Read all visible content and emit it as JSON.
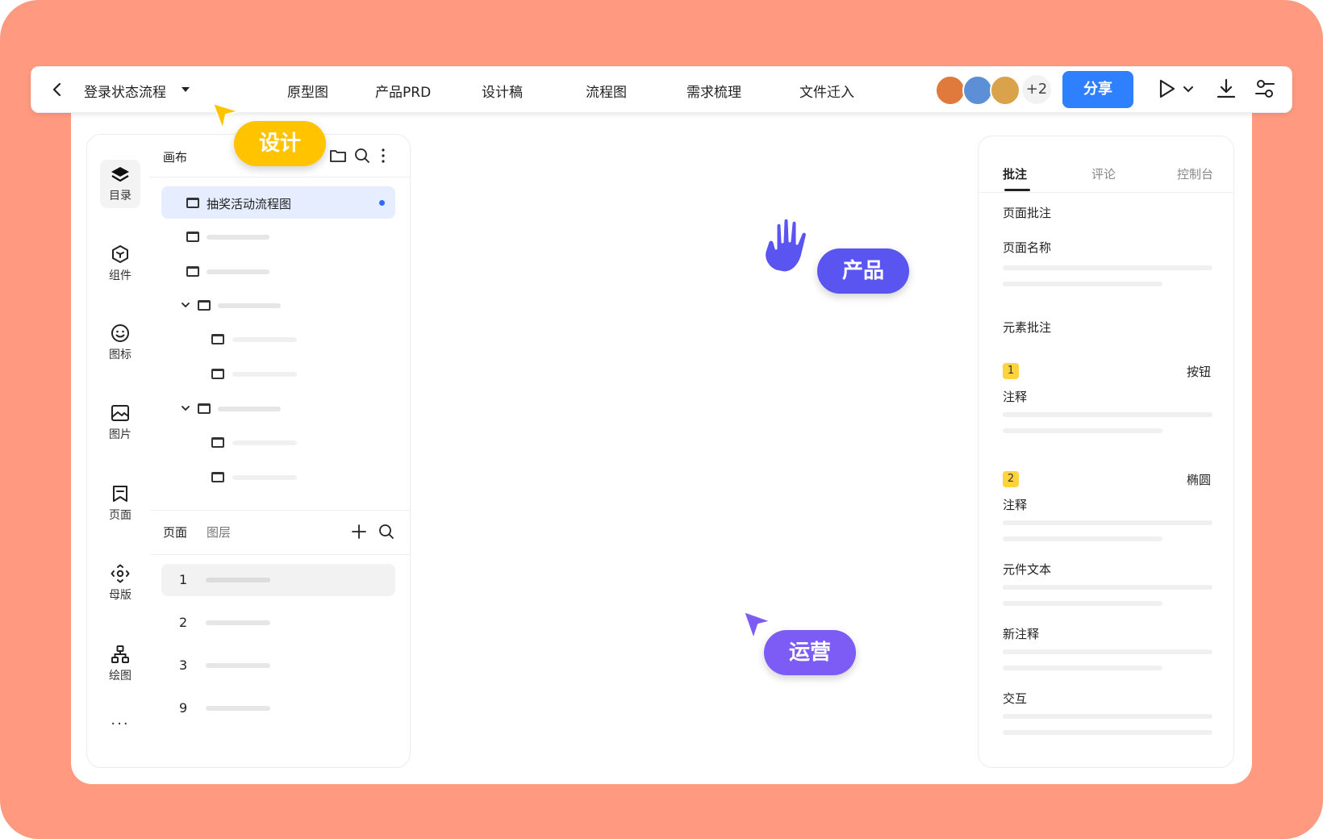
{
  "topbar": {
    "title": "登录状态流程",
    "nav": [
      "原型图",
      "产品PRD",
      "设计稿",
      "流程图",
      "需求梳理",
      "文件迁入"
    ],
    "avatars_more": "+2",
    "share_label": "分享"
  },
  "left_panel": {
    "rail": [
      "目录",
      "组件",
      "图标",
      "图片",
      "页面",
      "母版",
      "绘图"
    ],
    "rail_more": "···",
    "canvas_label": "画布",
    "active_item": "抽奖活动流程图",
    "pages_tab": "页面",
    "layers_tab": "图层",
    "pages": [
      "1",
      "2",
      "3",
      "9"
    ]
  },
  "right_panel": {
    "tabs": [
      "批注",
      "评论",
      "控制台"
    ],
    "page_note_title": "页面批注",
    "page_name_label": "页面名称",
    "element_note_title": "元素批注",
    "annotations": [
      {
        "num": "1",
        "type": "按钮",
        "label": "注释"
      },
      {
        "num": "2",
        "type": "椭圆",
        "label": "注释"
      }
    ],
    "component_text_label": "元件文本",
    "new_note_label": "新注释",
    "interaction_label": "交互"
  },
  "tags": {
    "design": "设计",
    "product": "产品",
    "ops": "运营"
  },
  "colors": {
    "background": "#FF9A80",
    "primary": "#2F80FF",
    "design_tag": "#FFC300",
    "product_tag": "#5A55F0",
    "ops_tag": "#7C5CF5",
    "badge": "#FFD33D"
  }
}
